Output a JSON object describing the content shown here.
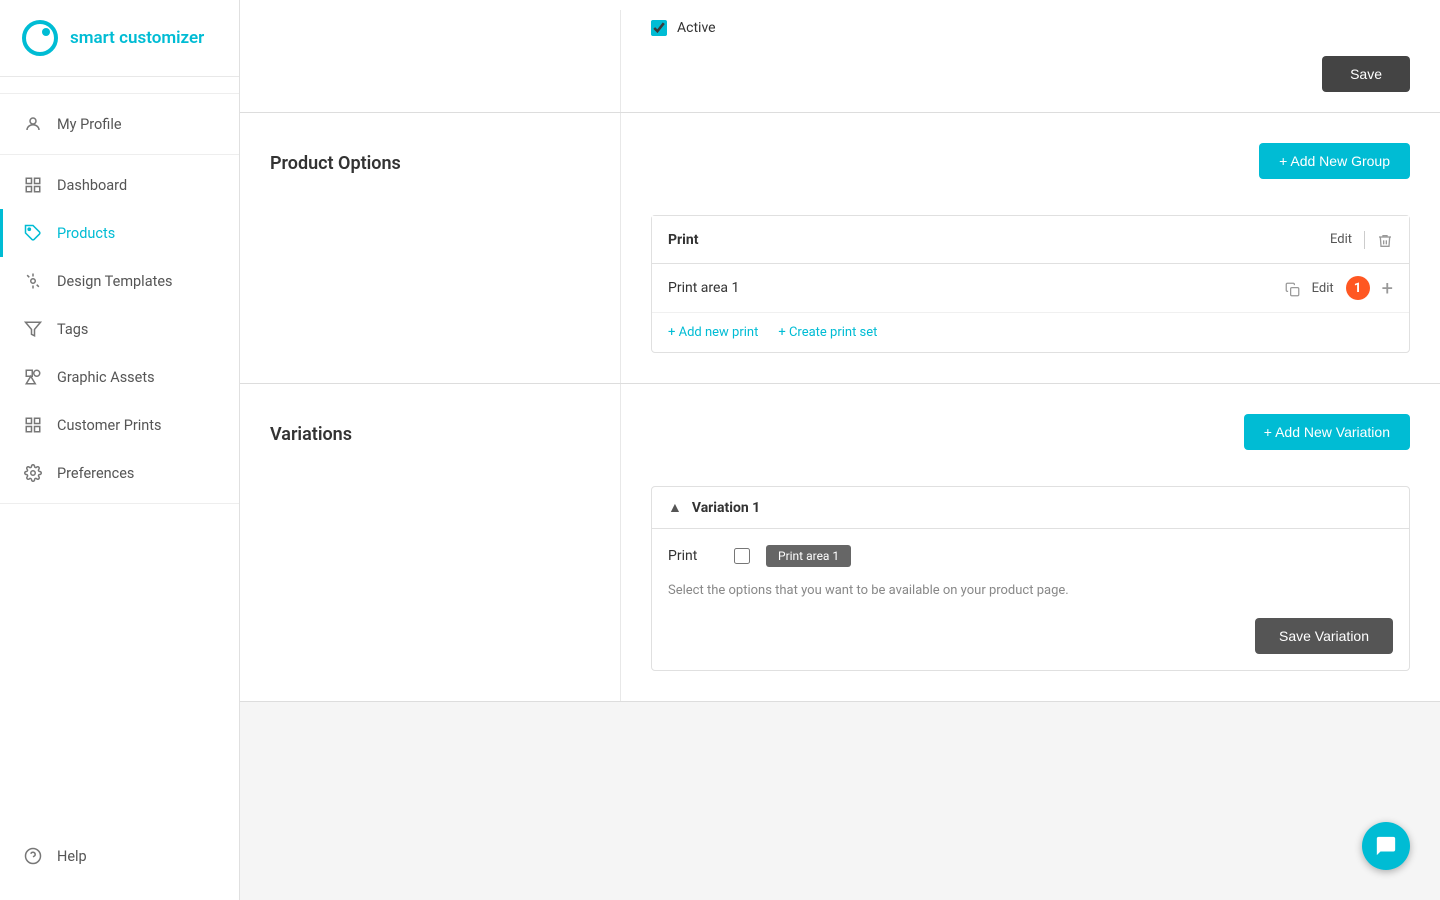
{
  "app": {
    "logo_text": "smart customizer"
  },
  "sidebar": {
    "items": [
      {
        "id": "my-profile",
        "label": "My Profile",
        "icon": "person"
      },
      {
        "id": "dashboard",
        "label": "Dashboard",
        "icon": "dashboard"
      },
      {
        "id": "products",
        "label": "Products",
        "icon": "tag",
        "active": true
      },
      {
        "id": "design-templates",
        "label": "Design Templates",
        "icon": "design"
      },
      {
        "id": "tags",
        "label": "Tags",
        "icon": "filter"
      },
      {
        "id": "graphic-assets",
        "label": "Graphic Assets",
        "icon": "shapes"
      },
      {
        "id": "customer-prints",
        "label": "Customer Prints",
        "icon": "grid"
      },
      {
        "id": "preferences",
        "label": "Preferences",
        "icon": "gear"
      },
      {
        "id": "help",
        "label": "Help",
        "icon": "question"
      }
    ]
  },
  "active_section": {
    "checkbox_label": "Active",
    "save_button": "Save"
  },
  "product_options": {
    "section_label": "Product Options",
    "add_group_button": "+ Add New Group",
    "print_group": {
      "title": "Print",
      "edit_label": "Edit",
      "print_area": {
        "name": "Print area 1",
        "edit_label": "Edit",
        "badge": "1"
      },
      "add_new_print": "+ Add new print",
      "create_print_set": "+ Create print set"
    }
  },
  "variations": {
    "section_label": "Variations",
    "add_variation_button": "+ Add New Variation",
    "variation_1": {
      "title": "Variation 1",
      "print_label": "Print",
      "print_area_tag": "Print area 1",
      "hint": "Select the options that you want to be available on your product page.",
      "save_button": "Save Variation"
    }
  }
}
